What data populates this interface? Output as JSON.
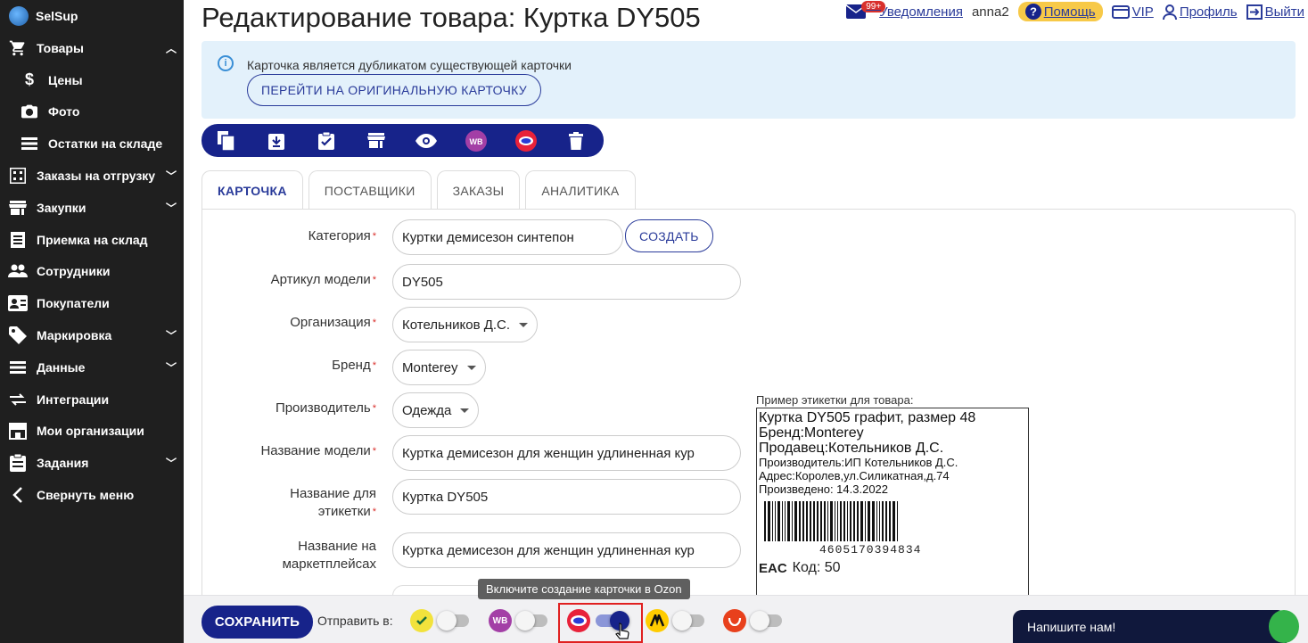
{
  "app": {
    "name": "SelSup"
  },
  "sidebar": {
    "items": [
      {
        "label": "Товары",
        "icon": "cart-icon"
      },
      {
        "label": "Цены",
        "icon": "dollar-icon"
      },
      {
        "label": "Фото",
        "icon": "camera-icon"
      },
      {
        "label": "Остатки на складе",
        "icon": "list-icon"
      },
      {
        "label": "Заказы на отгрузку",
        "icon": "calculator-icon"
      },
      {
        "label": "Закупки",
        "icon": "store-icon"
      },
      {
        "label": "Приемка на склад",
        "icon": "document-icon"
      },
      {
        "label": "Сотрудники",
        "icon": "people-icon"
      },
      {
        "label": "Покупатели",
        "icon": "contact-card-icon"
      },
      {
        "label": "Маркировка",
        "icon": "tag-icon"
      },
      {
        "label": "Данные",
        "icon": "list-icon"
      },
      {
        "label": "Интеграции",
        "icon": "arrows-icon"
      },
      {
        "label": "Мои организации",
        "icon": "storefront-icon"
      },
      {
        "label": "Задания",
        "icon": "clipboard-icon"
      },
      {
        "label": "Свернуть меню",
        "icon": "chevron-left-icon"
      }
    ]
  },
  "header": {
    "title": "Редактирование товара: Куртка DY505",
    "notifications_badge": "99+",
    "notifications_label": "Уведомления",
    "user": "anna2",
    "help_label": "Помощь",
    "vip_label": "VIP",
    "profile_label": "Профиль",
    "logout_label": "Выйти"
  },
  "info": {
    "text": "Карточка является дубликатом существующей карточки",
    "button": "ПЕРЕЙТИ НА ОРИГИНАЛЬНУЮ КАРТОЧКУ"
  },
  "toolbar": {
    "buttons": [
      "copy-icon",
      "download-icon",
      "clipboard-check-icon",
      "store-icon",
      "eye-icon",
      "wildberries-icon",
      "ozon-icon",
      "trash-icon"
    ],
    "wb_text": "WB"
  },
  "tabs": [
    "КАРТОЧКА",
    "ПОСТАВЩИКИ",
    "ЗАКАЗЫ",
    "АНАЛИТИКА"
  ],
  "form": {
    "category_label": "Категория",
    "category_value": "Куртки демисезон синтепон",
    "create_button": "СОЗДАТЬ",
    "article_label": "Артикул модели",
    "article_value": "DY505",
    "org_label": "Организация",
    "org_value": "Котельников Д.С.",
    "brand_label": "Бренд",
    "brand_value": "Monterey",
    "manufacturer_label": "Производитель",
    "manufacturer_value": "Одежда",
    "model_name_label": "Название модели",
    "model_name_value": "Куртка демисезон для женщин удлиненная кур",
    "label_name_label_1": "Название для",
    "label_name_label_2": "этикетки",
    "label_name_value": "Куртка DY505",
    "mp_name_label_1": "Название на",
    "mp_name_label_2": "маркетплейсах",
    "mp_name_value": "Куртка демисезон для женщин удлиненная кур"
  },
  "label_preview": {
    "title": "Пример этикетки для товара:",
    "line1": "Куртка DY505 графит, размер 48",
    "line2": "Бренд:Monterey",
    "line3": "Продавец:Котельников Д.С.",
    "line4": "Производитель:ИП Котельников Д.С.",
    "line5": "Адрес:Королев,ул.Силикатная,д.74",
    "line6": "Произведено: 14.3.2022",
    "barcode": "4605170394834",
    "eac": "EAC",
    "code": "Код: 50"
  },
  "bottom": {
    "save": "СОХРАНИТЬ",
    "send_to": "Отправить в:",
    "tooltip": "Включите создание карточки в Ozon",
    "chat": "Напишите нам!",
    "marketplaces": [
      {
        "name": "sber-icon",
        "color": "#f2e23c",
        "on": false
      },
      {
        "name": "wildberries-icon",
        "color": "#a33fa6",
        "on": false,
        "text": "WB"
      },
      {
        "name": "ozon-icon",
        "color": "#e8223a",
        "on": true
      },
      {
        "name": "yandex-market-icon",
        "color": "#ffcc00",
        "on": false
      },
      {
        "name": "aliexpress-icon",
        "color": "#e8401c",
        "on": false
      }
    ]
  },
  "colors": {
    "primary": "#17238a",
    "sidebar": "#1f1f1f",
    "info_bg": "#e3f1fb",
    "required": "#d9302c"
  }
}
